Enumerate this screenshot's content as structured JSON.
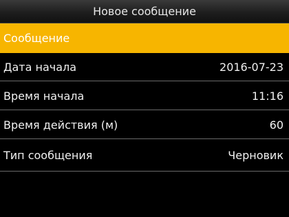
{
  "header": {
    "title": "Новое сообщение"
  },
  "menu": {
    "items": [
      {
        "label": "Сообщение",
        "value": ""
      },
      {
        "label": "Дата начала",
        "value": "2016-07-23"
      },
      {
        "label": "Время начала",
        "value": "11:16"
      },
      {
        "label": "Время действия (м)",
        "value": "60"
      },
      {
        "label": "Тип сообщения",
        "value": "Черновик"
      }
    ]
  },
  "colors": {
    "highlight": "#f7b500",
    "background": "#000000"
  }
}
